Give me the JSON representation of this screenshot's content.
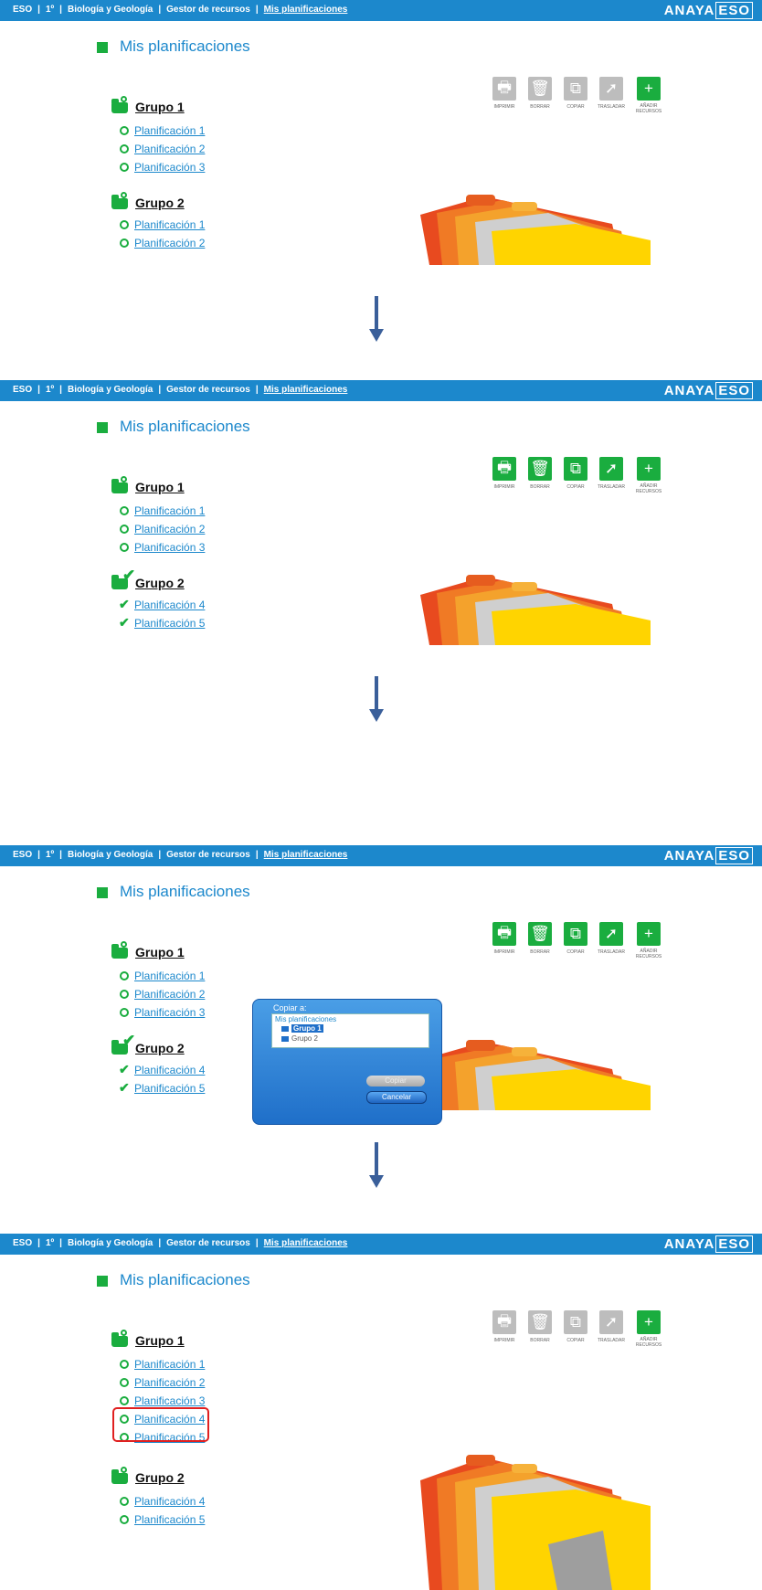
{
  "breadcrumb": {
    "eso": "ESO",
    "level": "1º",
    "subject": "Biología y Geología",
    "manager": "Gestor de recursos",
    "current": "Mis planificaciones"
  },
  "brand": {
    "anaya": "ANAYA",
    "eso": "ESO"
  },
  "page_title": "Mis planificaciones",
  "toolbar": {
    "print": "IMPRIMIR",
    "delete": "BORRAR",
    "copy": "COPIAR",
    "move": "TRASLADAR",
    "add_line1": "AÑADIR",
    "add_line2": "RECURSOS"
  },
  "colors": {
    "topbar": "#1c88cc",
    "accent_green": "#1aad3f",
    "link_blue": "#1c88cc",
    "highlight_red": "#e02020"
  },
  "steps": [
    {
      "groups": [
        {
          "name": "Grupo 1",
          "plans": [
            "Planificación 1",
            "Planificación 2",
            "Planificación 3"
          ]
        },
        {
          "name": "Grupo 2",
          "plans": [
            "Planificación 1",
            "Planificación 2"
          ]
        }
      ]
    },
    {
      "groups": [
        {
          "name": "Grupo 1",
          "plans": [
            "Planificación 1",
            "Planificación 2",
            "Planificación 3"
          ]
        },
        {
          "name": "Grupo 2",
          "checked": true,
          "plans": [
            "Planificación 4",
            "Planificación 5"
          ]
        }
      ]
    },
    {
      "groups": [
        {
          "name": "Grupo 1",
          "plans": [
            "Planificación 1",
            "Planificación 2",
            "Planificación 3"
          ]
        },
        {
          "name": "Grupo 2",
          "checked": true,
          "plans": [
            "Planificación 4",
            "Planificación 5"
          ]
        }
      ],
      "dialog": {
        "title": "Copiar a:",
        "root": "Mis planificaciones",
        "nodes": [
          "Grupo 1",
          "Grupo 2"
        ],
        "copy_btn": "Copiar",
        "cancel_btn": "Cancelar"
      }
    },
    {
      "groups": [
        {
          "name": "Grupo 1",
          "plans": [
            "Planificación 1",
            "Planificación 2",
            "Planificación 3",
            "Planificación 4",
            "Planificación 5"
          ]
        },
        {
          "name": "Grupo 2",
          "plans": [
            "Planificación 4",
            "Planificación 5"
          ]
        }
      ]
    }
  ]
}
